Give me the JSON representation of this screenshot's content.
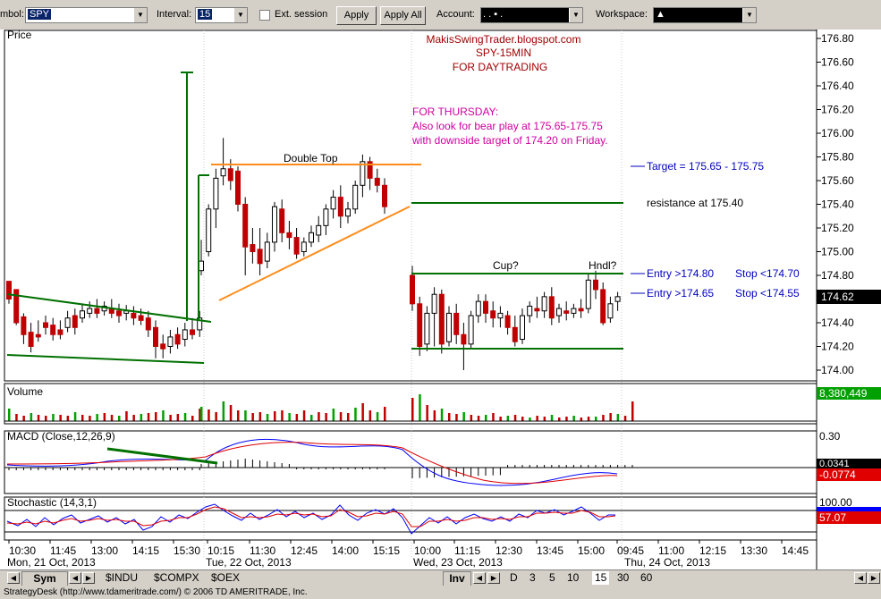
{
  "toolbar": {
    "symbol_label": "mbol:",
    "symbol_value": "SPY",
    "interval_label": "Interval:",
    "interval_value": "15",
    "ext_session_label": "Ext. session",
    "apply_label": "Apply",
    "apply_all_label": "Apply All",
    "account_label": "Account:",
    "account_value": ". .  ▪  .",
    "workspace_label": "Workspace:",
    "workspace_value": "▲"
  },
  "price_panel": {
    "title": "Price",
    "axis_ticks": [
      "176.80",
      "176.60",
      "176.40",
      "176.20",
      "176.00",
      "175.80",
      "175.60",
      "175.40",
      "175.20",
      "175.00",
      "174.80",
      "174.60",
      "174.40",
      "174.20",
      "174.00"
    ],
    "current_price": "174.62"
  },
  "annotations": {
    "header1": "MakisSwingTrader.blogspot.com",
    "header2": "SPY-15MIN",
    "header3": "FOR DAYTRADING",
    "thursday1": "FOR THURSDAY:",
    "thursday2": "Also look for bear play at 175.65-175.75",
    "thursday3": "with downside target of  174.20 on Friday.",
    "double_top": "Double Top",
    "cup": "Cup?",
    "handle": "Hndl?",
    "target": "Target = 175.65 - 175.75",
    "resistance": "resistance at 175.40",
    "entry1": "Entry >174.80",
    "stop1": "Stop <174.70",
    "entry2": "Entry >174.65",
    "stop2": "Stop <174.55"
  },
  "volume_panel": {
    "title": "Volume",
    "value": "8,380,449"
  },
  "macd_panel": {
    "title": "MACD (Close,12,26,9)",
    "tick_top": "0.30",
    "value1": "0.0341",
    "value2": "-0.0774"
  },
  "stoch_panel": {
    "title": "Stochastic (14,3,1)",
    "tick_top": "100.00",
    "value": "57.07"
  },
  "time_axis": {
    "labels": [
      "10:30",
      "11:45",
      "13:00",
      "14:15",
      "15:30",
      "10:15",
      "11:30",
      "12:45",
      "14:00",
      "15:15",
      "10:00",
      "11:15",
      "12:30",
      "13:45",
      "15:00",
      "09:45",
      "11:00",
      "12:15",
      "13:30",
      "14:45"
    ],
    "dates": [
      "Mon, 21 Oct, 2013",
      "Tue, 22 Oct, 2013",
      "Wed, 23 Oct, 2013",
      "Thu, 24 Oct, 2013"
    ]
  },
  "bottom_tabs": {
    "sym": "Sym",
    "tab1": "$INDU",
    "tab2": "$COMPX",
    "tab3": "$OEX",
    "inv": "Inv",
    "periods": [
      "D",
      "3",
      "5",
      "10",
      "15",
      "30",
      "60"
    ]
  },
  "status": "StrategyDesk (http://www.tdameritrade.com/) © 2006 TD AMERITRADE, Inc.",
  "colors": {
    "green": "#007000",
    "orange": "#ff8c1a",
    "red": "#c00000",
    "blue": "#0000c0",
    "magenta": "#d000a0",
    "brown": "#a00000"
  }
}
